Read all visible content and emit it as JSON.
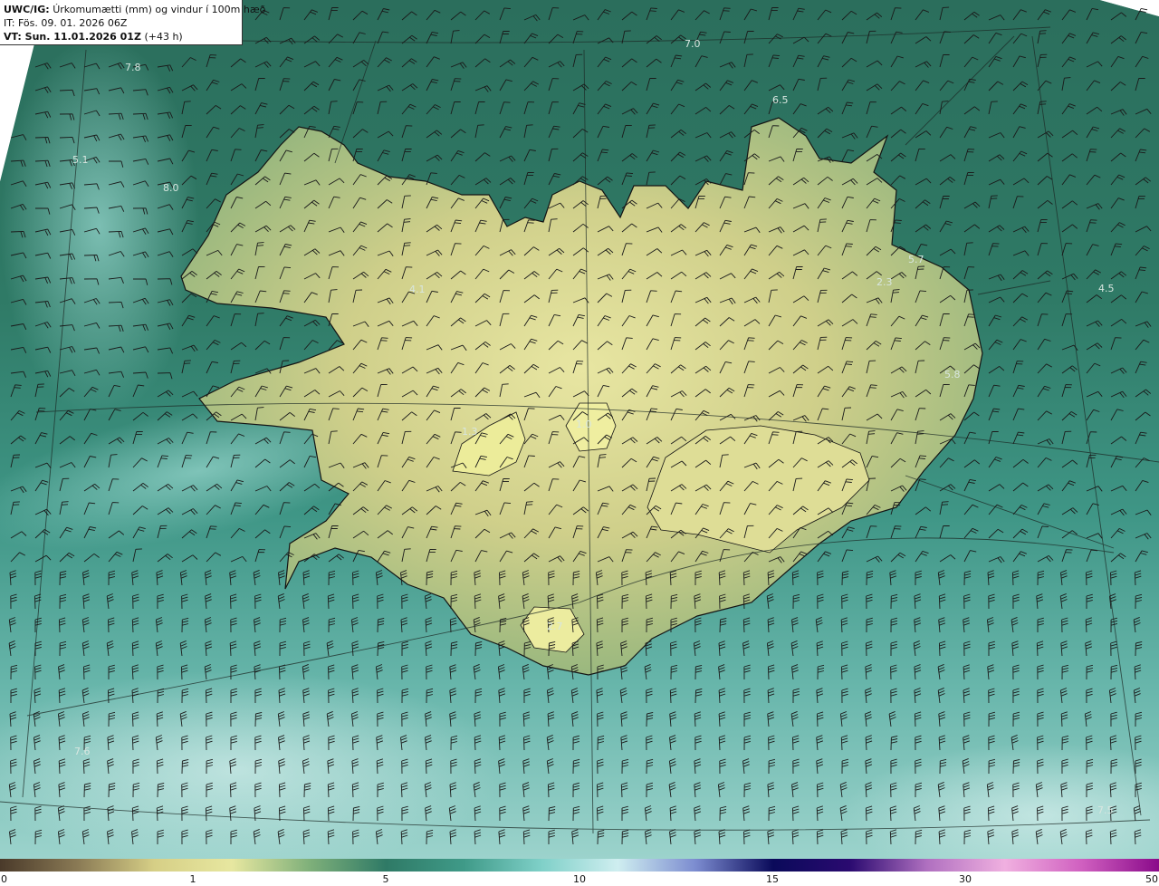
{
  "header": {
    "model_label": "UWC/IG:",
    "title_text": "Úrkomumætti (mm) og vindur í 100m hæð",
    "init_time": "IT: Fös. 09. 01. 2026 06Z",
    "valid_label": "VT: Sun. 11.01.2026 01Z",
    "lead_time": "(+43 h)"
  },
  "value_labels": [
    "7.0",
    "6.5",
    "7.8",
    "5.1",
    "8.0",
    "4.1",
    "5.7",
    "2.3",
    "4.5",
    "5.8",
    "1.0",
    "1.3",
    "2.7",
    "7.6",
    "7.5"
  ],
  "colorbar": {
    "ticks": [
      "0",
      "1",
      "5",
      "10",
      "15",
      "30",
      "50"
    ],
    "colors": [
      "#4a3a2a",
      "#8a7a55",
      "#d6cf86",
      "#e7e7a0",
      "#7fb07a",
      "#2f7a66",
      "#3f9a88",
      "#7fd0c8",
      "#cfeef0",
      "#7c8cd0",
      "#0a0a5a",
      "#2a0a70",
      "#b070c0",
      "#f0b0e0",
      "#d060c0",
      "#8a0a8a"
    ]
  },
  "colors": {
    "ocean_north": "#2e7460",
    "ocean_south": "#6fbdb3",
    "land_low": "#c6c781",
    "land_high": "#e4e39c",
    "coastline": "#141414",
    "barb": "#1a1a1a"
  }
}
